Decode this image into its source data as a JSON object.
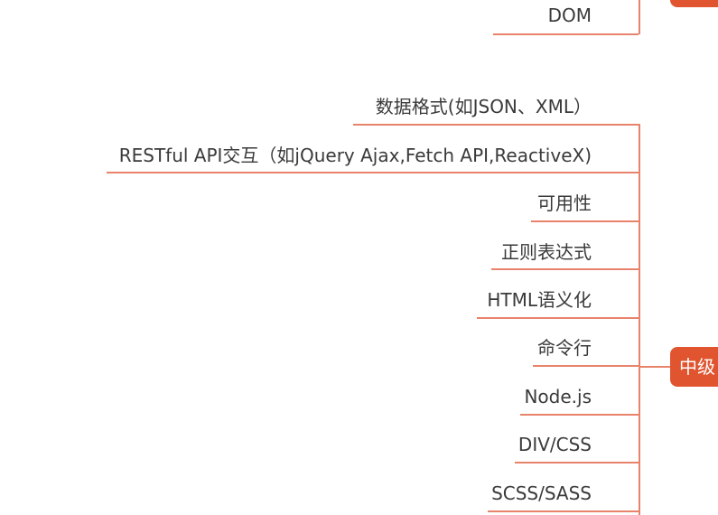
{
  "top_node": "DOM",
  "children": [
    "数据格式(如JSON、XML）",
    "RESTful API交互（如jQuery Ajax,Fetch API,ReactiveX)",
    "可用性",
    "正则表达式",
    "HTML语义化",
    "命令行",
    "Node.js",
    "DIV/CSS",
    "SCSS/SASS"
  ],
  "hub_label": "中级",
  "colors": {
    "connector": "#e8836b",
    "hub": "#e0542f",
    "text": "#3a3a3a"
  }
}
